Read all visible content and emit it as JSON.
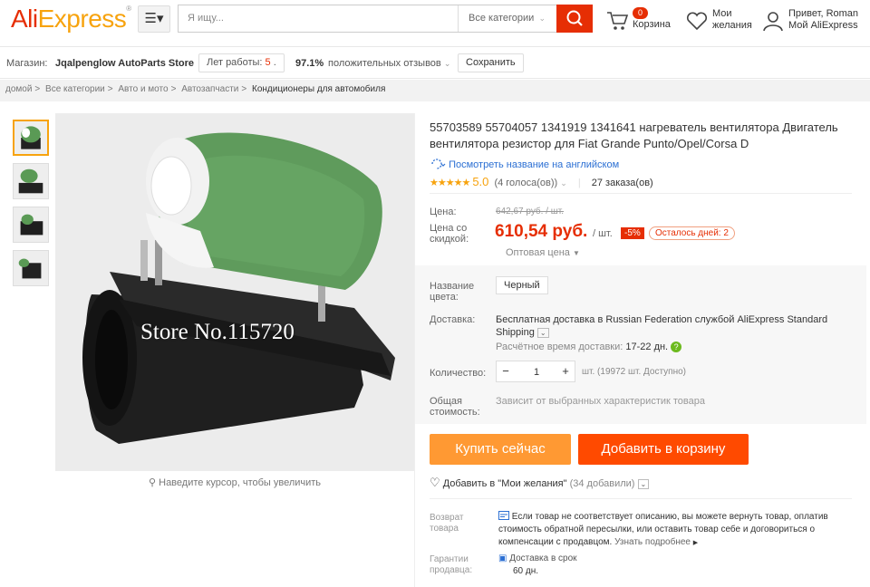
{
  "header": {
    "logo": "AliExpress",
    "search_placeholder": "Я ищу...",
    "category_select": "Все категории",
    "cart_count": "0",
    "cart_label": "Корзина",
    "wishlist_label_1": "Мои",
    "wishlist_label_2": "желания",
    "account_line_1": "Привет, Roman",
    "account_line_2": "Мой AliExpress"
  },
  "store": {
    "label": "Магазин:",
    "name": "Jqalpenglow AutoParts Store",
    "years_label": "Лет работы:",
    "years_value": "5",
    "positive_pct": "97.1%",
    "positive_label": "положительных отзывов",
    "save_label": "Сохранить"
  },
  "breadcrumb": [
    "домой",
    "Все категории",
    "Авто и мото",
    "Автозапчасти",
    "Кондиционеры для автомобиля"
  ],
  "gallery": {
    "watermark": "Store No.115720",
    "zoom_hint": "Наведите курсор, чтобы увеличить"
  },
  "product": {
    "title": "55703589 55704057 1341919 1341641 нагреватель вентилятора Двигатель вентилятора резистор для Fiat Grande Punto/Opel/Corsa D",
    "translate_link": "Посмотреть название на английском",
    "rating": "5.0",
    "votes": "(4 голоса(ов))",
    "orders": "27 заказа(ов)",
    "price_label": "Цена:",
    "old_price": "642,67 руб. / шт.",
    "sale_label_1": "Цена со",
    "sale_label_2": "скидкой:",
    "price": "610,54 руб.",
    "per_unit": "/ шт.",
    "discount": "-5%",
    "days_left": "Осталось дней: 2",
    "wholesale": "Оптовая цена"
  },
  "options": {
    "color_label_1": "Название",
    "color_label_2": "цвета:",
    "color_value": "Черный",
    "shipping_label": "Доставка:",
    "shipping_text": "Бесплатная доставка в Russian Federation службой AliExpress Standard Shipping",
    "eta_label": "Расчётное время доставки:",
    "eta_value": "17-22 дн.",
    "qty_label": "Количество:",
    "qty_value": "1",
    "availability": "шт. (19972 шт. Доступно)",
    "total_label_1": "Общая",
    "total_label_2": "стоимость:",
    "total_value": "Зависит от выбранных характеристик товара"
  },
  "actions": {
    "buy_now": "Купить сейчас",
    "add_to_cart": "Добавить в корзину",
    "add_wishlist": "Добавить в \"Мои желания\"",
    "wishlist_count": "(34 добавили)"
  },
  "returns": {
    "label_1": "Возврат",
    "label_2": "товара",
    "text": "Если товар не соответствует описанию, вы можете вернуть товар, оплатив стоимость обратной пересылки, или оставить товар себе и договориться о компенсации с продавцом.",
    "more": "Узнать подробнее"
  },
  "guarantee": {
    "label_1": "Гарантии",
    "label_2": "продавца:",
    "title": "Доставка в срок",
    "value": "60 дн."
  },
  "colors": {
    "accent": "#e62e04",
    "buy": "#ff9933",
    "cart": "#ff4a00",
    "link": "#2b6fd3"
  }
}
